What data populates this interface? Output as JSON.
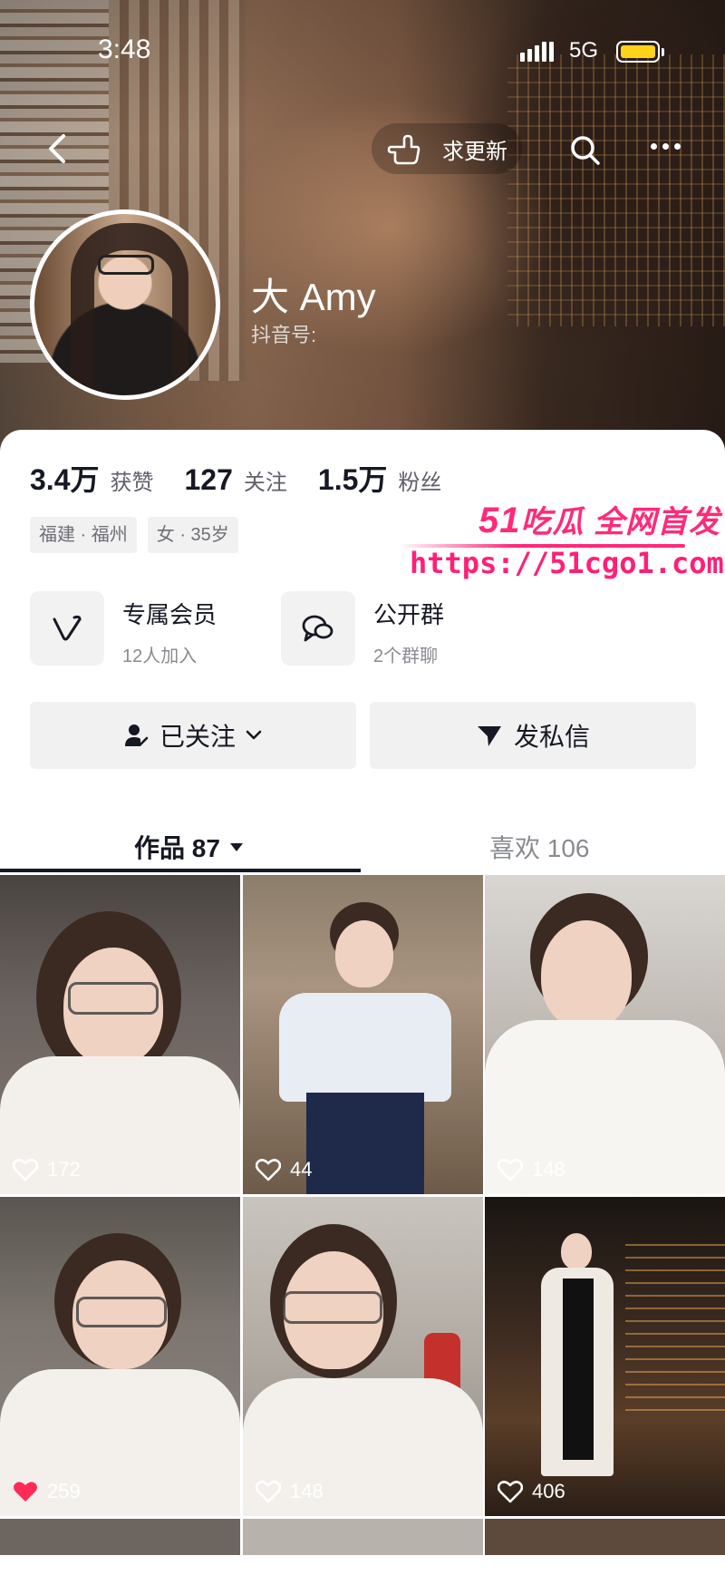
{
  "status_bar": {
    "time": "3:48",
    "network": "5G",
    "battery_color": "#ffd21a"
  },
  "nav": {
    "back_icon": "chevron-left-icon",
    "update_label": "求更新",
    "search_icon": "search-icon",
    "more_icon": "more-dots-icon"
  },
  "profile": {
    "name": "大 Amy",
    "douyin_id_label": "抖音号:"
  },
  "stats": [
    {
      "value": "3.4万",
      "label": "获赞"
    },
    {
      "value": "127",
      "label": "关注"
    },
    {
      "value": "1.5万",
      "label": "粉丝"
    }
  ],
  "tags": [
    "福建 · 福州",
    "女 · 35岁"
  ],
  "watermark": {
    "line1_num": "51",
    "line1_text": "吃瓜 全网首发",
    "line2": "https://51cgo1.com",
    "color": "#ff2a7a"
  },
  "features": [
    {
      "title": "专属会员",
      "subtitle": "12人加入",
      "icon": "v-icon"
    },
    {
      "title": "公开群",
      "subtitle": "2个群聊",
      "icon": "group-chat-icon"
    }
  ],
  "actions": {
    "follow_label": "已关注",
    "message_label": "发私信"
  },
  "tabs": {
    "works_label": "作品 87",
    "likes_label": "喜欢 106"
  },
  "videos": [
    {
      "likes": "172",
      "liked": false
    },
    {
      "likes": "44",
      "liked": false
    },
    {
      "likes": "148",
      "liked": false
    },
    {
      "likes": "259",
      "liked": true
    },
    {
      "likes": "148",
      "liked": false
    },
    {
      "likes": "406",
      "liked": false
    }
  ],
  "colors": {
    "like_active": "#fe2c55",
    "text_primary": "#161823",
    "text_secondary": "#8a8b91"
  }
}
